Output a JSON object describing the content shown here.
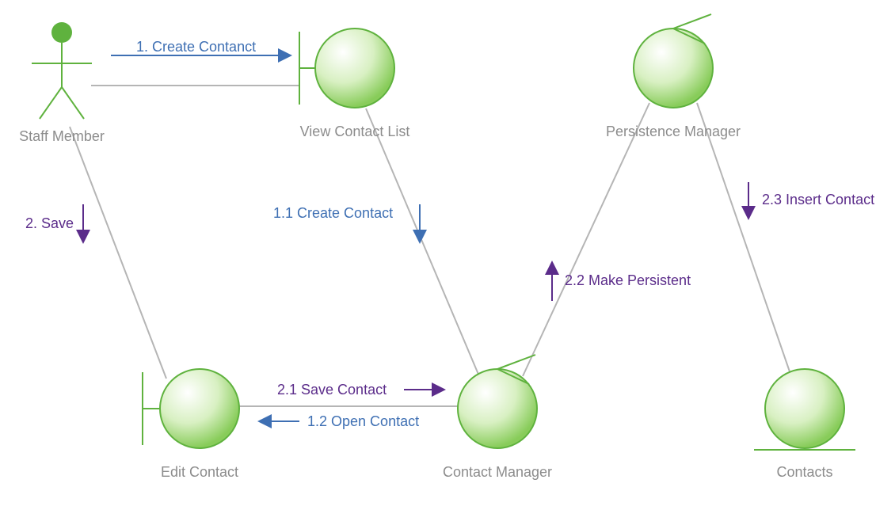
{
  "diagram": {
    "type": "UML Collaboration Diagram",
    "nodes": {
      "staff": {
        "label": "Staff Member",
        "kind": "actor"
      },
      "viewList": {
        "label": "View Contact List",
        "kind": "boundary"
      },
      "editContact": {
        "label": "Edit Contact",
        "kind": "boundary"
      },
      "contactMgr": {
        "label": "Contact Manager",
        "kind": "control"
      },
      "persistMgr": {
        "label": "Persistence Manager",
        "kind": "control"
      },
      "contacts": {
        "label": "Contacts",
        "kind": "entity"
      }
    },
    "messages": {
      "m1": {
        "text": "1. Create Contanct",
        "color": "blue"
      },
      "m2": {
        "text": "2. Save",
        "color": "purple"
      },
      "m11": {
        "text": "1.1 Create Contact",
        "color": "blue"
      },
      "m12": {
        "text": "1.2 Open Contact",
        "color": "blue"
      },
      "m21": {
        "text": "2.1 Save Contact",
        "color": "purple"
      },
      "m22": {
        "text": "2.2 Make Persistent",
        "color": "purple"
      },
      "m23": {
        "text": "2.3 Insert Contact",
        "color": "purple"
      }
    },
    "links": [
      {
        "from": "staff",
        "to": "viewList"
      },
      {
        "from": "staff",
        "to": "editContact"
      },
      {
        "from": "viewList",
        "to": "contactMgr"
      },
      {
        "from": "editContact",
        "to": "contactMgr"
      },
      {
        "from": "contactMgr",
        "to": "persistMgr"
      },
      {
        "from": "persistMgr",
        "to": "contacts"
      }
    ]
  }
}
